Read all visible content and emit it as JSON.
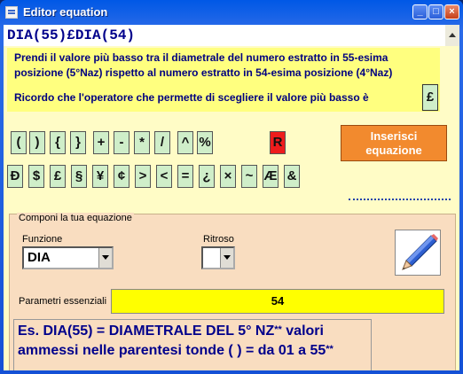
{
  "window": {
    "title": "Editor equation"
  },
  "equation": {
    "display": "DIA(55)£DIA(54)"
  },
  "instructions": {
    "line1": "Prendi il valore più basso tra il diametrale del numero estratto in 55-esima",
    "line2": "posizione (5°Naz) rispetto al numero estratto in 54-esima posizione (4°Naz)",
    "line3": "Ricordo che l'operatore che permette di scegliere il valore più basso è",
    "operator": "£"
  },
  "symbols": {
    "row1": [
      "(",
      ")",
      "{",
      "}",
      "+",
      "-",
      "*",
      "/",
      "^",
      "%"
    ],
    "special": "R",
    "row2": [
      "Ð",
      "$",
      "£",
      "§",
      "¥",
      "¢",
      ">",
      "<",
      "=",
      "¿",
      "×",
      "~",
      "Æ",
      "&"
    ]
  },
  "insert_button": {
    "line1": "Inserisci",
    "line2": "equazione"
  },
  "panel": {
    "title": "Componi la tua equazione",
    "function_label": "Funzione",
    "function_value": "DIA",
    "ritroso_label": "Ritroso",
    "ritroso_value": "",
    "param_label": "Parametri essenziali",
    "param_value": "54",
    "example_line1": "Es. DIA(55)  =  DIAMETRALE DEL 5° NZ",
    "example_line1_sup": "**",
    "example_line1_end": " valori",
    "example_line2": "ammessi  nelle parentesi tonde ( ) = da 01 a 55",
    "example_line2_sup": "**"
  },
  "icons": {
    "pencil": "pencil-icon",
    "app": "app-icon"
  }
}
